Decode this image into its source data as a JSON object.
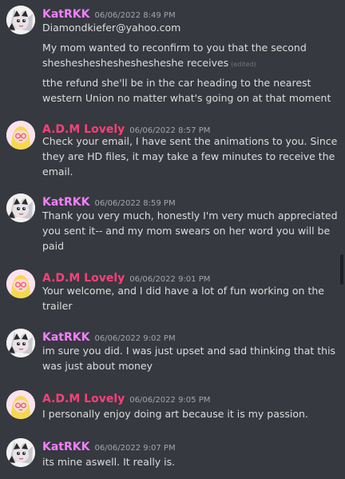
{
  "messages": [
    {
      "username": "KatRKK",
      "avatar": "kat-avatar",
      "timestamp": "06/06/2022 8:49 PM",
      "lines": [
        "Diamondkiefer@yahoo.com",
        "My mom wanted to reconfirm to you that the second",
        "sheshesheshesheshesheshe receives",
        "tthe refund she'll be in the car heading to the nearest",
        "western Union no matter what's going on at that moment"
      ],
      "edited_label": "(edited)"
    },
    {
      "username": "A.D.M Lovely",
      "avatar": "adm-avatar",
      "timestamp": "06/06/2022 8:57 PM",
      "lines": [
        "Check your email, I have sent the animations to you. Since",
        "they are HD files, it may take a few minutes to receive the",
        "email."
      ]
    },
    {
      "username": "KatRKK",
      "avatar": "kat-avatar",
      "timestamp": "06/06/2022 8:59 PM",
      "lines": [
        "Thank you very much, honestly I'm very much appreciated",
        "you sent it-- and my mom swears on her word you will be",
        "paid"
      ]
    },
    {
      "username": "A.D.M Lovely",
      "avatar": "adm-avatar",
      "timestamp": "06/06/2022 9:01 PM",
      "lines": [
        "Your welcome, and I did have a lot of fun working on the",
        "trailer"
      ]
    },
    {
      "username": "KatRKK",
      "avatar": "kat-avatar",
      "timestamp": "06/06/2022 9:02 PM",
      "lines": [
        "im sure you did. I was just upset and sad thinking that this",
        "was just about money"
      ]
    },
    {
      "username": "A.D.M Lovely",
      "avatar": "adm-avatar",
      "timestamp": "06/06/2022 9:05 PM",
      "lines": [
        "I personally enjoy doing art because it is my passion."
      ]
    },
    {
      "username": "KatRKK",
      "avatar": "kat-avatar",
      "timestamp": "06/06/2022 9:07 PM",
      "lines": [
        "its mine aswell. It really is."
      ]
    }
  ],
  "colors": {
    "background": "#36393f",
    "kat_name": "#f47fff",
    "adm_name": "#ff3f7a",
    "text": "#dcddde",
    "timestamp": "#a3a6aa"
  }
}
